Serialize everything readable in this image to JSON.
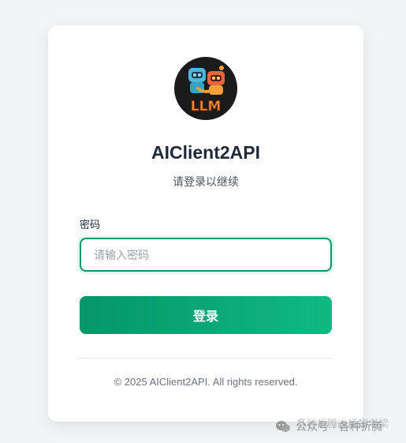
{
  "app": {
    "title": "AIClient2API",
    "subtitle": "请登录以继续",
    "logo_text": "LLM"
  },
  "form": {
    "password_label": "密码",
    "password_placeholder": "请输入密码",
    "password_value": "",
    "login_button": "登录"
  },
  "footer": {
    "copyright": "© 2025 AIClient2API. All rights reserved."
  },
  "watermark": {
    "back_text": "各种折腾@杨翊老梁",
    "front_text": "公众号 · 各种折腾",
    "icon": "wechat-icon"
  },
  "colors": {
    "accent": "#059669",
    "accent_light": "#10b981",
    "background": "#f3f4f6"
  }
}
